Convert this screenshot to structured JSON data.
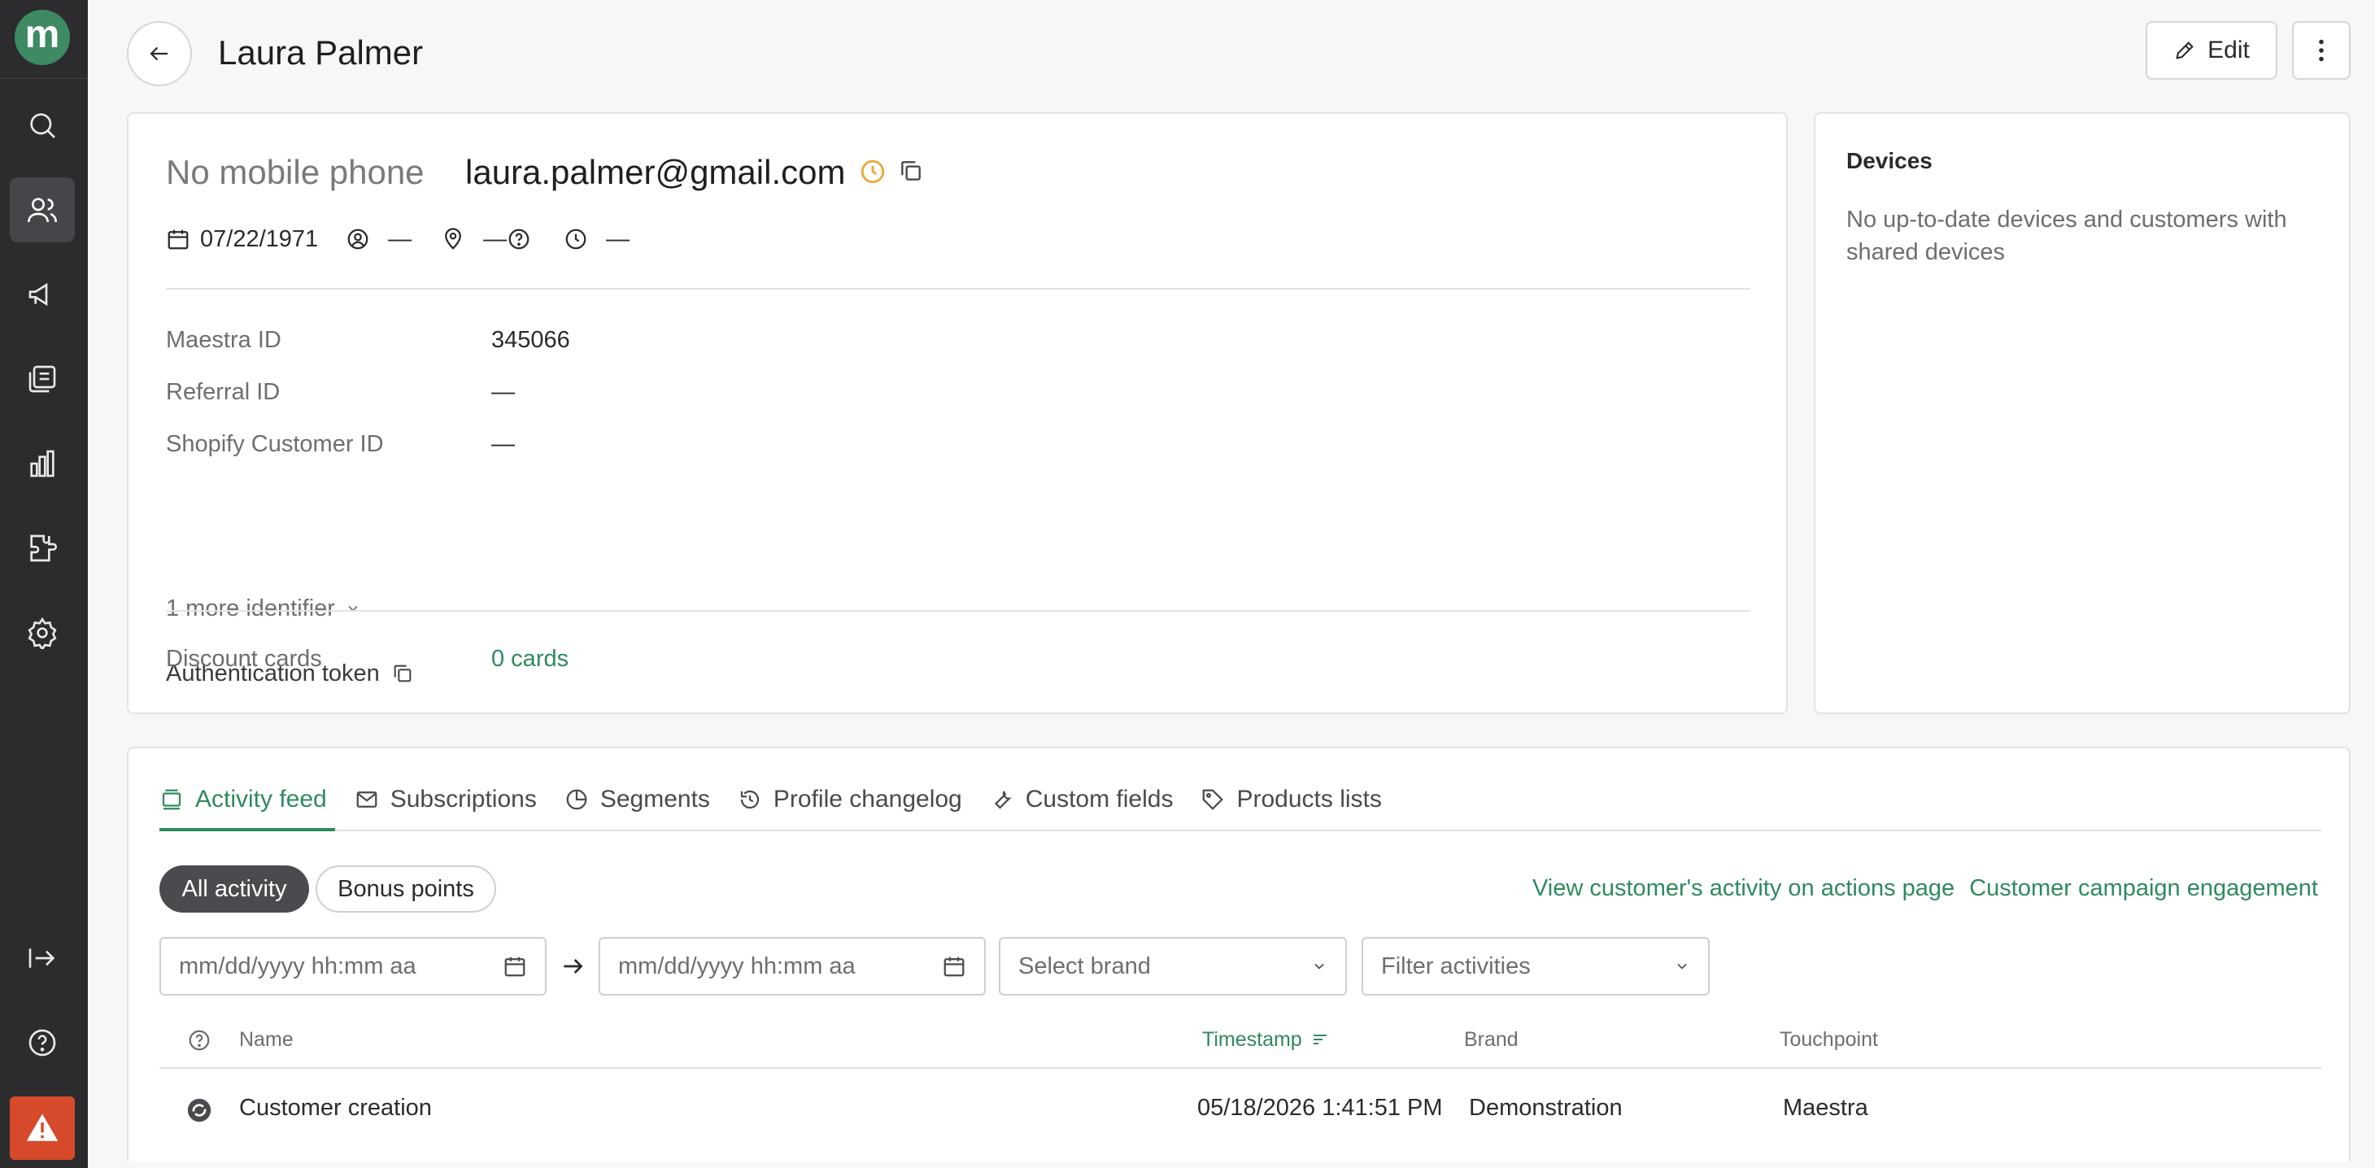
{
  "app": {
    "logo_letter": "m"
  },
  "header": {
    "title": "Laura Palmer",
    "edit_label": "Edit"
  },
  "profile": {
    "phone": "No mobile phone",
    "email": "laura.palmer@gmail.com",
    "birthdate": "07/22/1971",
    "gender": "—",
    "location": "—",
    "timezone": "—",
    "identifiers": [
      {
        "label": "Maestra ID",
        "value": "345066"
      },
      {
        "label": "Referral ID",
        "value": "—"
      },
      {
        "label": "Shopify Customer ID",
        "value": "—"
      }
    ],
    "more_identifier": "1 more identifier",
    "auth_token_label": "Authentication token",
    "discount_label": "Discount cards",
    "discount_value": "0 cards"
  },
  "devices": {
    "title": "Devices",
    "empty_text": "No up-to-date devices and customers with shared devices"
  },
  "tabs": [
    {
      "label": "Activity feed",
      "icon": "feed-icon",
      "active": true
    },
    {
      "label": "Subscriptions",
      "icon": "mail-icon"
    },
    {
      "label": "Segments",
      "icon": "pie-icon"
    },
    {
      "label": "Profile changelog",
      "icon": "history-icon"
    },
    {
      "label": "Custom fields",
      "icon": "wrench-icon"
    },
    {
      "label": "Products lists",
      "icon": "tag-icon"
    }
  ],
  "activity": {
    "filters": {
      "all": "All activity",
      "bonus": "Bonus points"
    },
    "links": {
      "actions": "View customer's activity on actions page",
      "engagement": "Customer campaign engagement"
    },
    "date_from_placeholder": "mm/dd/yyyy hh:mm aa",
    "date_to_placeholder": "mm/dd/yyyy hh:mm aa",
    "brand_placeholder": "Select brand",
    "activities_placeholder": "Filter activities",
    "columns": {
      "name": "Name",
      "timestamp": "Timestamp",
      "brand": "Brand",
      "touchpoint": "Touchpoint"
    },
    "rows": [
      {
        "name": "Customer creation",
        "timestamp": "05/18/2026 1:41:51 PM",
        "brand": "Demonstration",
        "touchpoint": "Maestra"
      }
    ]
  },
  "colors": {
    "accent": "#2f8a5e",
    "sidebar": "#2c2c2e",
    "alert": "#d64a2b",
    "status_pending": "#e8a93a"
  }
}
